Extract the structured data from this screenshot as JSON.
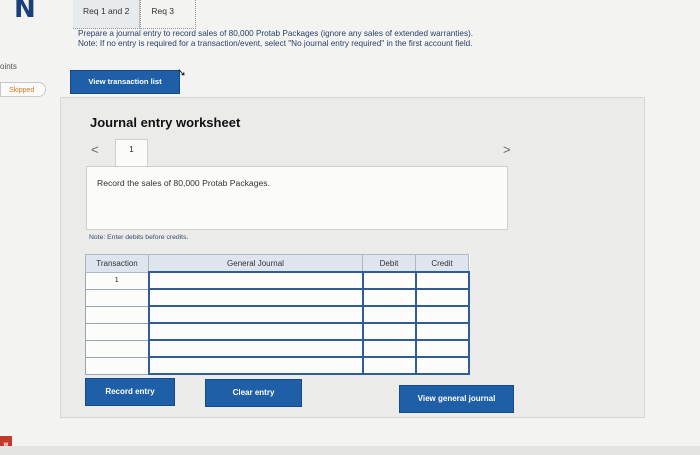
{
  "top_icon": "N",
  "left": {
    "points_label": "oints",
    "skipped_label": "Skipped"
  },
  "tabs": [
    {
      "label": "Req 1 and 2"
    },
    {
      "label": "Req 3"
    }
  ],
  "instructions": {
    "text": "Prepare a journal entry to record sales of 80,000 Protab Packages (ignore any sales of extended warranties).",
    "note": "Note: If no entry is required for a transaction/event, select \"No journal entry required\" in the first account field."
  },
  "view_transaction_list_label": "View transaction list",
  "worksheet": {
    "title": "Journal entry worksheet",
    "entry_tab": "1",
    "description": "Record the sales of 80,000 Protab Packages.",
    "note": "Note: Enter debits before credits."
  },
  "journal": {
    "columns": [
      "Transaction",
      "General Journal",
      "Debit",
      "Credit"
    ],
    "rows": [
      {
        "transaction": "1"
      },
      {
        "transaction": ""
      },
      {
        "transaction": ""
      },
      {
        "transaction": ""
      },
      {
        "transaction": ""
      },
      {
        "transaction": ""
      }
    ]
  },
  "buttons": {
    "record": "Record entry",
    "clear": "Clear entry",
    "view_general": "View general journal"
  },
  "corner_badge": "w"
}
